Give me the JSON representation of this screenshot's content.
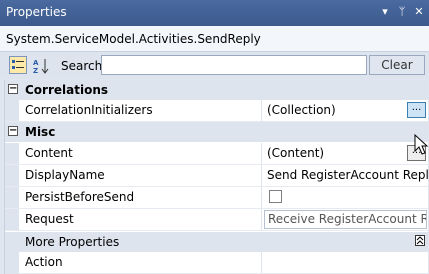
{
  "window": {
    "title": "Properties",
    "buttons": [
      "▾",
      "ᛘ",
      "✕"
    ]
  },
  "type_name": "System.ServiceModel.Activities.SendReply",
  "toolbar": {
    "search_label": "Search:",
    "search_value": "",
    "clear_label": "Clear"
  },
  "categories": {
    "correlations": {
      "label": "Correlations",
      "toggle": "−"
    },
    "misc": {
      "label": "Misc",
      "toggle": "−"
    }
  },
  "properties": {
    "correlation_initializers": {
      "name": "CorrelationInitializers",
      "value": "(Collection)",
      "button": "..."
    },
    "content": {
      "name": "Content",
      "value": "(Content)",
      "button": "..."
    },
    "display_name": {
      "name": "DisplayName",
      "value": "Send RegisterAccount Reply"
    },
    "persist_before_send": {
      "name": "PersistBeforeSend",
      "checked": false
    },
    "request": {
      "name": "Request",
      "value": "Receive RegisterAccount Req"
    }
  },
  "more_properties": {
    "label": "More Properties",
    "items": [
      {
        "name": "Action",
        "value": ""
      }
    ]
  },
  "colors": {
    "title_bar": "#3c5a8c",
    "category_bg": "#dde4ee"
  }
}
